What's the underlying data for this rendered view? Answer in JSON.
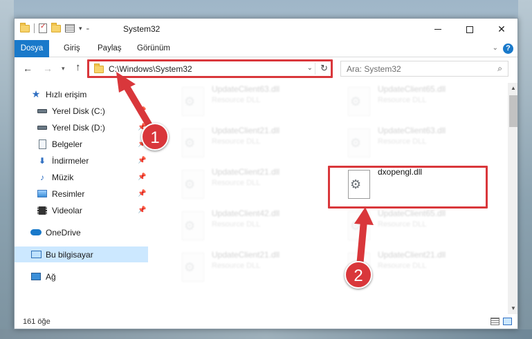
{
  "window": {
    "title": "System32",
    "controls": {
      "minimize": "–",
      "maximize": "□",
      "close": "✕"
    }
  },
  "ribbon": {
    "tabs": [
      {
        "label": "Dosya",
        "active": true
      },
      {
        "label": "Giriş"
      },
      {
        "label": "Paylaş"
      },
      {
        "label": "Görünüm"
      }
    ],
    "help": "?"
  },
  "address_bar": {
    "path": "C:\\Windows\\System32",
    "search_placeholder": "Ara: System32"
  },
  "navigation": {
    "quick_access_label": "Hızlı erişim",
    "items": [
      {
        "label": "Yerel Disk (C:)",
        "icon": "drive-icon",
        "pinned": true
      },
      {
        "label": "Yerel Disk (D:)",
        "icon": "drive-icon",
        "pinned": true
      },
      {
        "label": "Belgeler",
        "icon": "document-icon",
        "pinned": true
      },
      {
        "label": "İndirmeler",
        "icon": "download-icon",
        "pinned": true
      },
      {
        "label": "Müzik",
        "icon": "music-icon",
        "pinned": true
      },
      {
        "label": "Resimler",
        "icon": "pictures-icon",
        "pinned": true
      },
      {
        "label": "Videolar",
        "icon": "video-icon",
        "pinned": true
      }
    ],
    "onedrive": "OneDrive",
    "this_pc": "Bu bilgisayar",
    "network": "Ağ"
  },
  "files": [
    {
      "name": "UpdateClient63.dll",
      "type": "Resource DLL",
      "dimmed": true
    },
    {
      "name": "UpdateClient65.dll",
      "type": "Resource DLL",
      "dimmed": true
    },
    {
      "name": "UpdateClient21.dll",
      "type": "Resource DLL",
      "dimmed": true
    },
    {
      "name": "UpdateClient63.dll",
      "type": "Resource DLL",
      "dimmed": true
    },
    {
      "name": "UpdateClient21.dll",
      "type": "Resource DLL",
      "dimmed": true
    },
    {
      "name": "dxopengl.dll",
      "type": "",
      "dimmed": false
    },
    {
      "name": "UpdateClient42.dll",
      "type": "Resource DLL",
      "dimmed": true
    },
    {
      "name": "UpdateClient65.dll",
      "type": "Resource DLL",
      "dimmed": true
    },
    {
      "name": "UpdateClient21.dll",
      "type": "Resource DLL",
      "dimmed": true
    },
    {
      "name": "UpdateClient21.dll",
      "type": "Resource DLL",
      "dimmed": true
    }
  ],
  "status": {
    "item_count": "161 öğe"
  },
  "annotations": {
    "badge_1": "1",
    "badge_2": "2",
    "highlight_color": "#d9373b"
  },
  "colors": {
    "accent": "#1979ca",
    "selection": "#cce8ff"
  }
}
